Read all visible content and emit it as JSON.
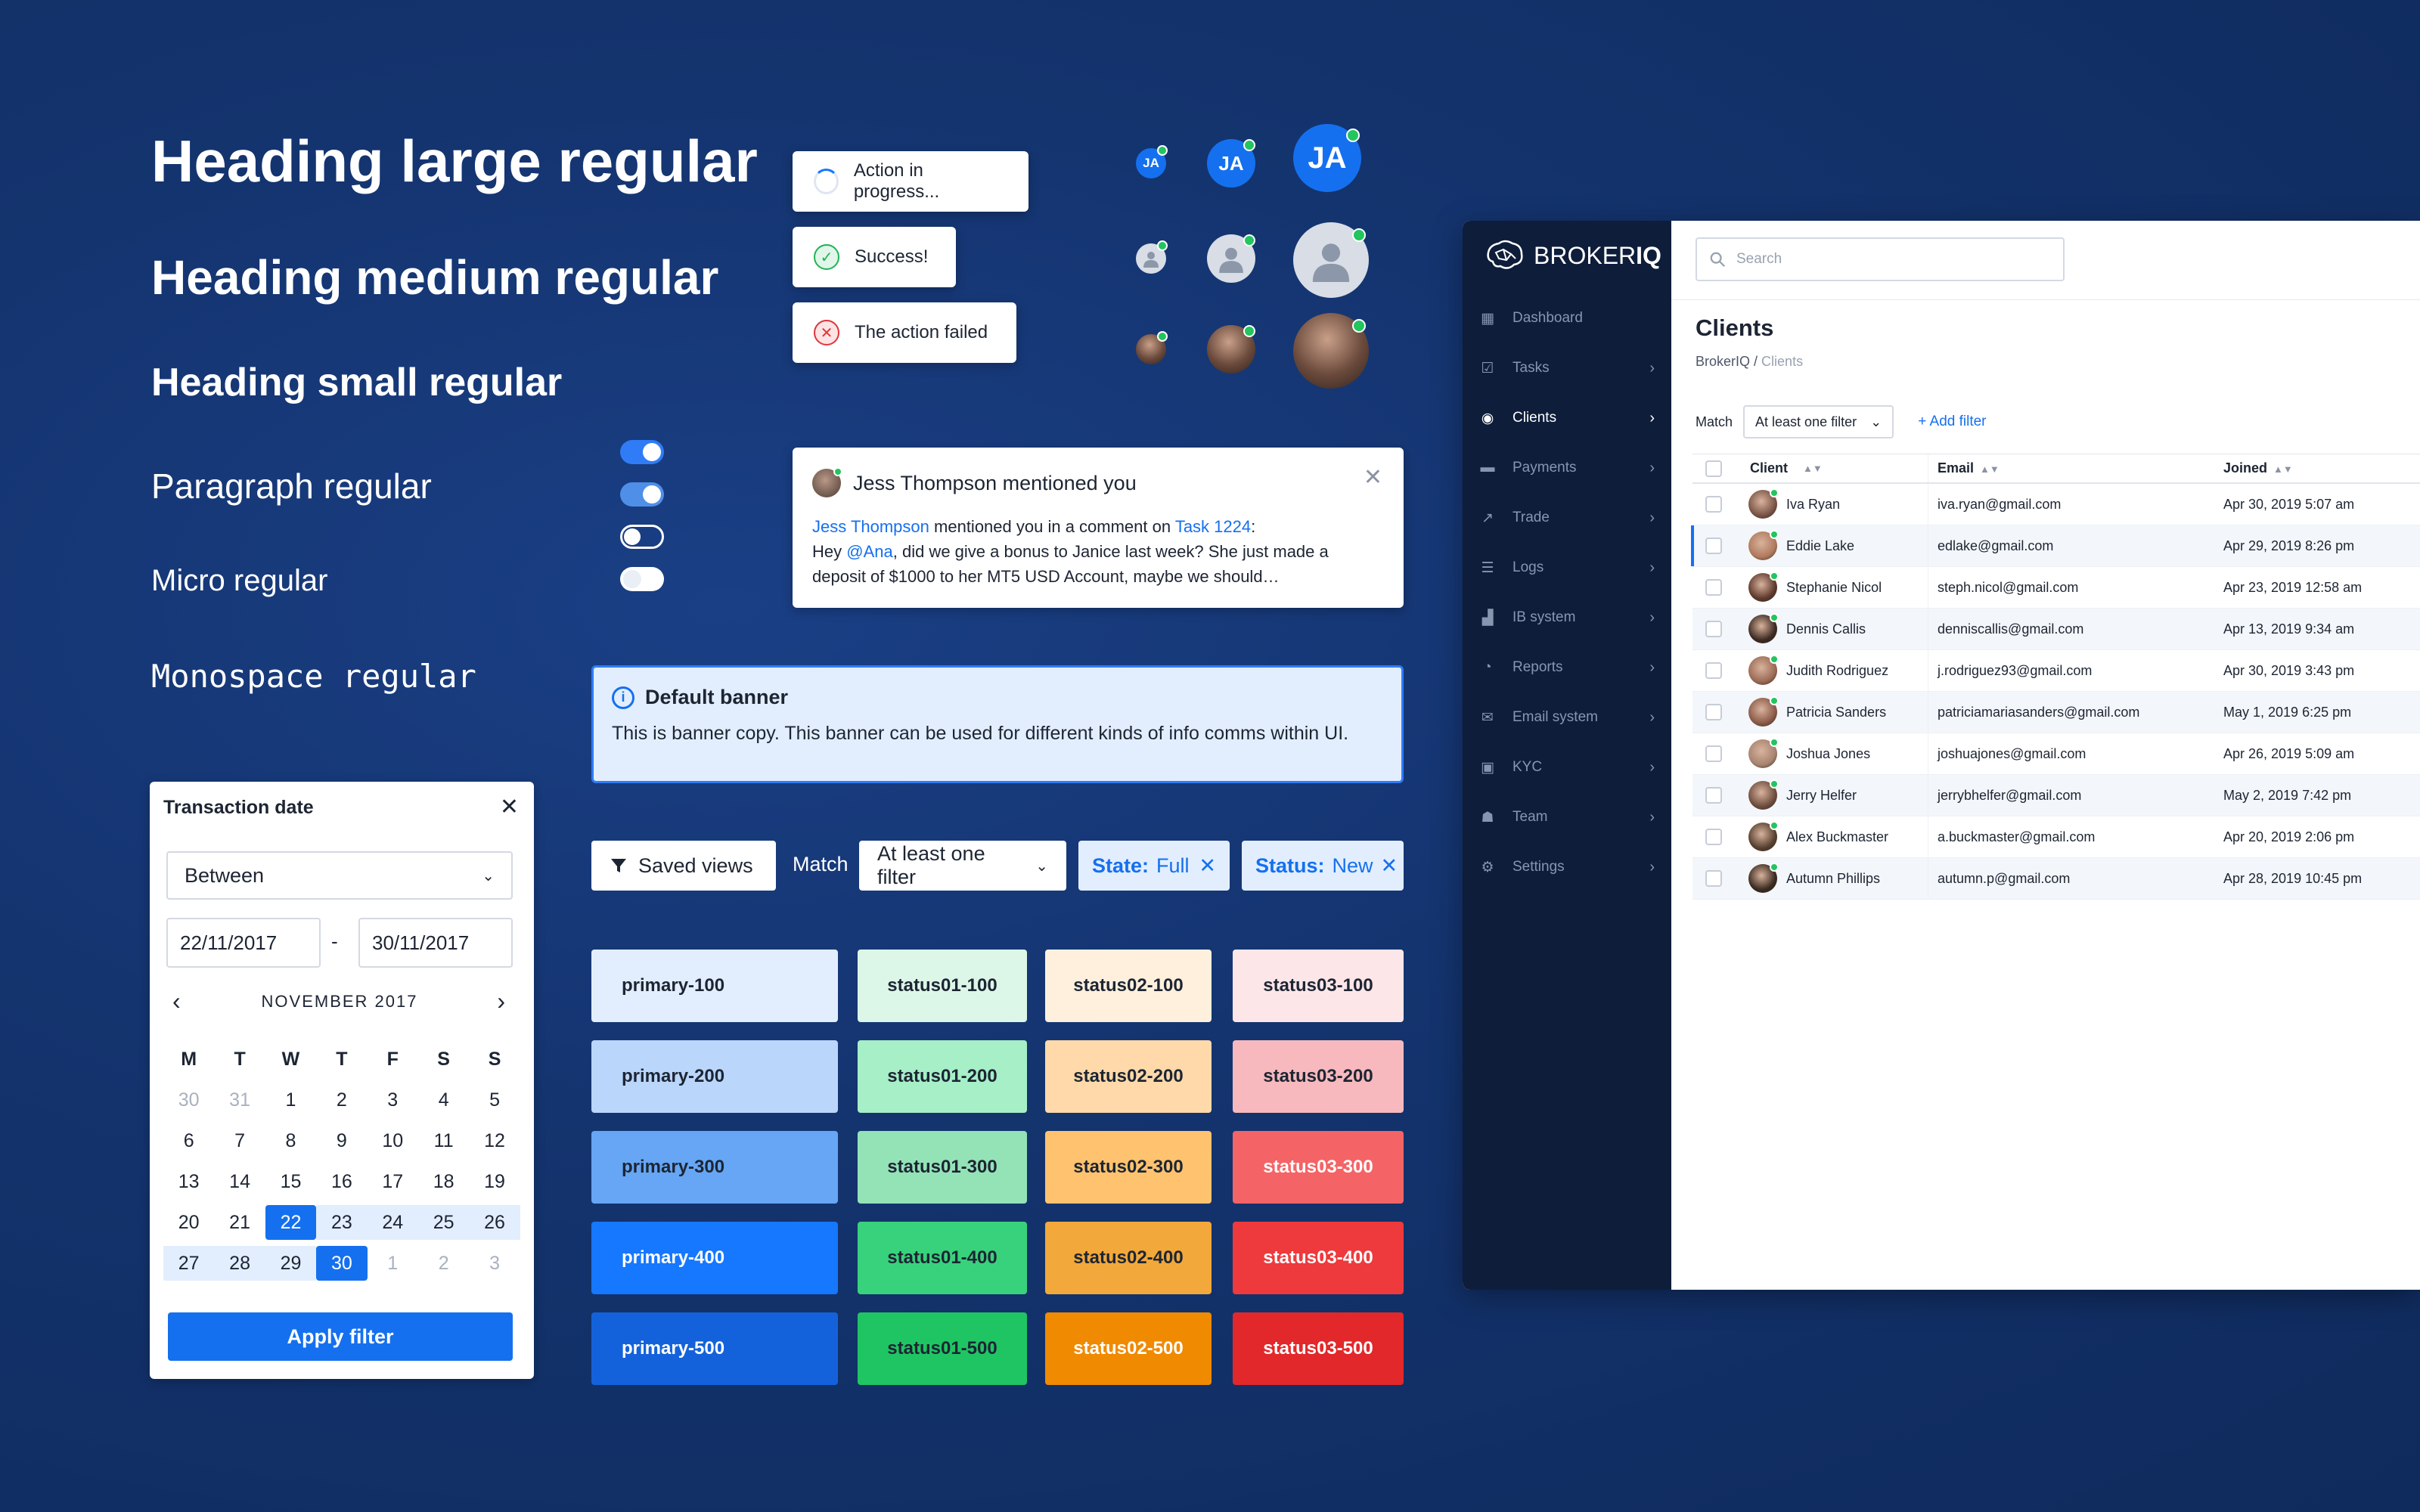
{
  "typography": {
    "heading_large": "Heading large regular",
    "heading_medium": "Heading medium regular",
    "heading_small": "Heading small regular",
    "paragraph": "Paragraph regular",
    "micro": "Micro regular",
    "monospace": "Monospace regular"
  },
  "toasts": {
    "progress": "Action in progress...",
    "success": "Success!",
    "failed": "The action failed"
  },
  "avatars": {
    "initials": "JA"
  },
  "notification": {
    "title": "Jess Thompson mentioned you",
    "author": "Jess Thompson",
    "mid_text": " mentioned you in a comment on ",
    "task_link": "Task 1224",
    "colon": ":",
    "line2_prefix": "Hey ",
    "mention": "@Ana",
    "line2_rest": ", did we give a bonus to Janice last week? She just made a",
    "line3": "deposit of $1000 to her MT5 USD Account, maybe we should…"
  },
  "banner": {
    "title": "Default banner",
    "body": "This is banner copy. This banner can be used for different kinds of info comms within UI."
  },
  "filter_bar": {
    "saved_views": "Saved views",
    "match_label": "Match",
    "match_value": "At least one filter",
    "chip_state_key": "State:",
    "chip_state_val": "Full",
    "chip_status_key": "Status:",
    "chip_status_val": "New"
  },
  "swatches": {
    "primary": [
      "primary-100",
      "primary-200",
      "primary-300",
      "primary-400",
      "primary-500"
    ],
    "status01": [
      "status01-100",
      "status01-200",
      "status01-300",
      "status01-400",
      "status01-500"
    ],
    "status02": [
      "status02-100",
      "status02-200",
      "status02-300",
      "status02-400",
      "status02-500"
    ],
    "status03": [
      "status03-100",
      "status03-200",
      "status03-300",
      "status03-400",
      "status03-500"
    ],
    "colors": {
      "primary": [
        "#e2eefe",
        "#bad6fb",
        "#66a6f4",
        "#1677ff",
        "#1462db"
      ],
      "status01": [
        "#dcf7e7",
        "#a6efc7",
        "#94e3b7",
        "#38d27c",
        "#1fc563"
      ],
      "status02": [
        "#fff0dd",
        "#ffd9a9",
        "#ffc36f",
        "#f2a83a",
        "#f08a00"
      ],
      "status03": [
        "#fde6e8",
        "#f7b9bd",
        "#f46466",
        "#ee3a3d",
        "#e2282a"
      ]
    }
  },
  "date_picker": {
    "title": "Transaction date",
    "range_mode": "Between",
    "from": "22/11/2017",
    "dash": "-",
    "to": "30/11/2017",
    "month": "NOVEMBER 2017",
    "weekdays": [
      "M",
      "T",
      "W",
      "T",
      "F",
      "S",
      "S"
    ],
    "apply": "Apply filter"
  },
  "app": {
    "brand_light": "BROKER",
    "brand_bold": "IQ",
    "search_placeholder": "Search",
    "nav": [
      "Dashboard",
      "Tasks",
      "Clients",
      "Payments",
      "Trade",
      "Logs",
      "IB system",
      "Reports",
      "Email system",
      "KYC",
      "Team",
      "Settings"
    ],
    "page_title": "Clients",
    "crumb_root": "BrokerIQ",
    "crumb_sep": " / ",
    "crumb_current": "Clients",
    "match_label": "Match",
    "match_value": "At least one filter",
    "add_filter": "Add filter",
    "columns": [
      "Client",
      "Email",
      "Joined"
    ],
    "rows": [
      {
        "name": "Iva Ryan",
        "email": "iva.ryan@gmail.com",
        "joined": "Apr 30, 2019 5:07 am"
      },
      {
        "name": "Eddie Lake",
        "email": "edlake@gmail.com",
        "joined": "Apr 29, 2019 8:26 pm"
      },
      {
        "name": "Stephanie Nicol",
        "email": "steph.nicol@gmail.com",
        "joined": "Apr 23, 2019 12:58 am"
      },
      {
        "name": "Dennis Callis",
        "email": "denniscallis@gmail.com",
        "joined": "Apr 13, 2019 9:34 am"
      },
      {
        "name": "Judith Rodriguez",
        "email": "j.rodriguez93@gmail.com",
        "joined": "Apr 30, 2019 3:43 pm"
      },
      {
        "name": "Patricia Sanders",
        "email": "patriciamariasanders@gmail.com",
        "joined": "May 1, 2019 6:25 pm"
      },
      {
        "name": "Joshua Jones",
        "email": "joshuajones@gmail.com",
        "joined": "Apr 26, 2019 5:09 am"
      },
      {
        "name": "Jerry Helfer",
        "email": "jerrybhelfer@gmail.com",
        "joined": "May 2, 2019 7:42 pm"
      },
      {
        "name": "Alex Buckmaster",
        "email": "a.buckmaster@gmail.com",
        "joined": "Apr 20, 2019 2:06 pm"
      },
      {
        "name": "Autumn Phillips",
        "email": "autumn.p@gmail.com",
        "joined": "Apr 28, 2019 10:45 pm"
      }
    ]
  }
}
